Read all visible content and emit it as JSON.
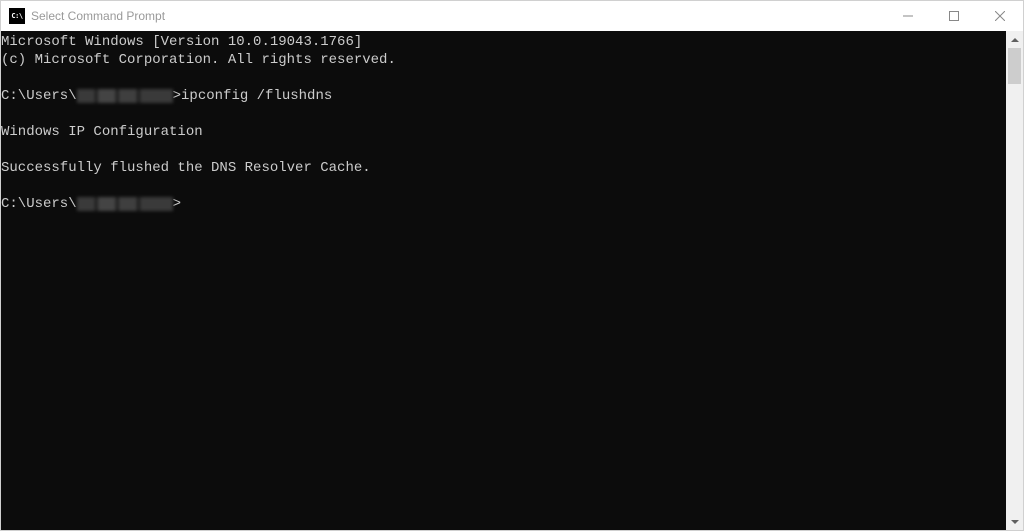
{
  "window": {
    "icon_text": "C:\\",
    "title": "Select Command Prompt"
  },
  "terminal": {
    "line1": "Microsoft Windows [Version 10.0.19043.1766]",
    "line2": "(c) Microsoft Corporation. All rights reserved.",
    "prompt1_prefix": "C:\\Users\\",
    "prompt1_suffix": ">",
    "command1": "ipconfig /flushdns",
    "heading": "Windows IP Configuration",
    "result": "Successfully flushed the DNS Resolver Cache.",
    "prompt2_prefix": "C:\\Users\\",
    "prompt2_suffix": ">"
  }
}
